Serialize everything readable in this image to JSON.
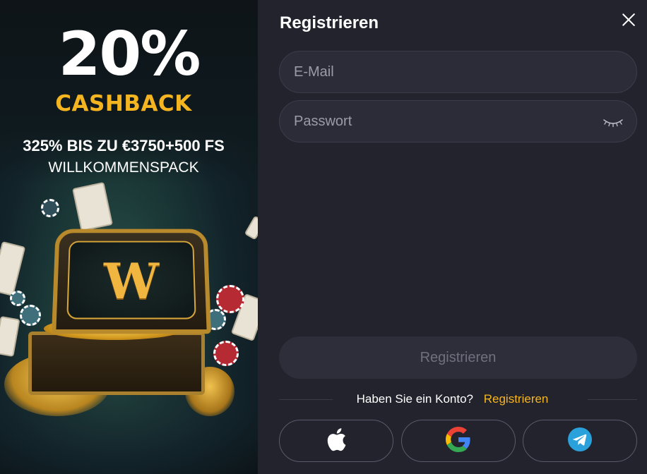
{
  "promo": {
    "percent": "20%",
    "cashback": "CASHBACK",
    "line1": "325% BIS ZU €3750+500 FS",
    "line2": "WILLKOMMENSPACK",
    "chest_letter": "W"
  },
  "form": {
    "title": "Registrieren",
    "email": {
      "placeholder": "E-Mail",
      "value": ""
    },
    "password": {
      "placeholder": "Passwort",
      "value": ""
    },
    "submit_label": "Registrieren",
    "account_question": "Haben Sie ein Konto?",
    "account_link": "Registrieren",
    "social": [
      {
        "name": "apple-icon"
      },
      {
        "name": "google-icon"
      },
      {
        "name": "telegram-icon"
      }
    ]
  },
  "colors": {
    "accent": "#f5b520",
    "panel_bg": "#23232e",
    "field_bg": "#2c2c39",
    "telegram": "#2aa1da"
  }
}
